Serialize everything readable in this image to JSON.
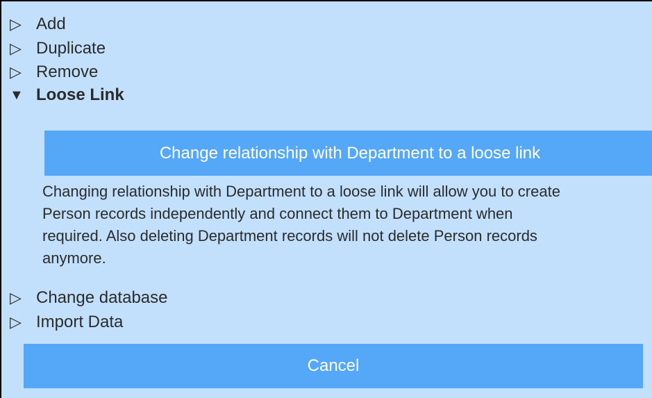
{
  "menu": {
    "items": [
      {
        "label": "Add",
        "icon": "collapsed-triangle-icon"
      },
      {
        "label": "Duplicate",
        "icon": "collapsed-triangle-icon"
      },
      {
        "label": "Remove",
        "icon": "collapsed-triangle-icon"
      },
      {
        "label": "Loose Link",
        "icon": "expanded-triangle-icon"
      },
      {
        "label": "Change database",
        "icon": "collapsed-triangle-icon"
      },
      {
        "label": "Import Data",
        "icon": "collapsed-triangle-icon"
      }
    ],
    "collapsed_glyph": "▷",
    "expanded_glyph": "▼"
  },
  "loose_link": {
    "button_label": "Change relationship with Department to a loose link",
    "description": "Changing relationship with Department to a loose link will allow you to create\nPerson records independently and connect them to Department when\nrequired. Also deleting Department records will not delete Person records\nanymore."
  },
  "footer": {
    "cancel_label": "Cancel"
  },
  "colors": {
    "panel_background": "#c2e0fc",
    "button_background": "#55a7f8",
    "button_text": "#ffffff",
    "text": "#2b2b2b"
  }
}
